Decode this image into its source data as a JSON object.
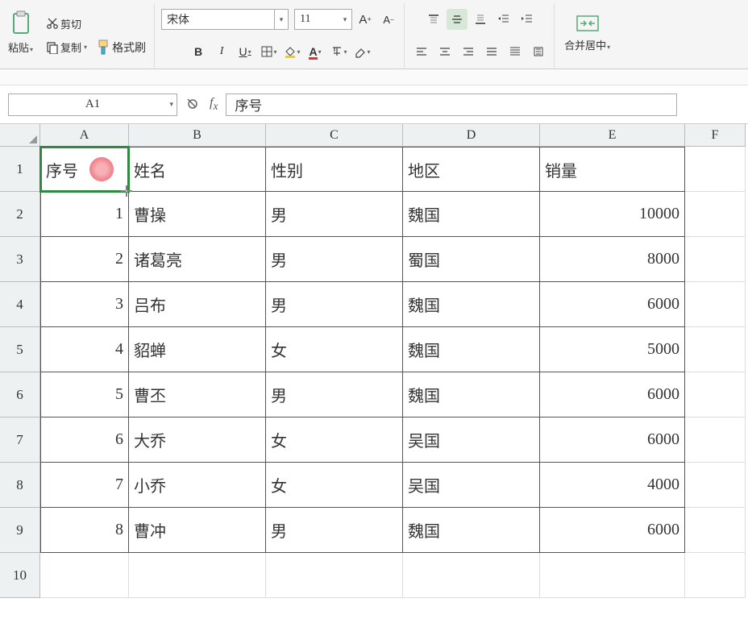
{
  "toolbar": {
    "paste_label": "粘贴",
    "cut_label": "剪切",
    "copy_label": "复制",
    "formatpainter_label": "格式刷",
    "font_name": "宋体",
    "font_size": "11",
    "merge_label": "合并居中"
  },
  "namebox": "A1",
  "formula": "序号",
  "columns": [
    "A",
    "B",
    "C",
    "D",
    "E",
    "F"
  ],
  "header_row": [
    "序号",
    "姓名",
    "性别",
    "地区",
    "销量"
  ],
  "data_rows": [
    [
      "1",
      "曹操",
      "男",
      "魏国",
      "10000"
    ],
    [
      "2",
      "诸葛亮",
      "男",
      "蜀国",
      "8000"
    ],
    [
      "3",
      "吕布",
      "男",
      "魏国",
      "6000"
    ],
    [
      "4",
      "貂蝉",
      "女",
      "魏国",
      "5000"
    ],
    [
      "5",
      "曹丕",
      "男",
      "魏国",
      "6000"
    ],
    [
      "6",
      "大乔",
      "女",
      "吴国",
      "6000"
    ],
    [
      "7",
      "小乔",
      "女",
      "吴国",
      "4000"
    ],
    [
      "8",
      "曹冲",
      "男",
      "魏国",
      "6000"
    ]
  ]
}
